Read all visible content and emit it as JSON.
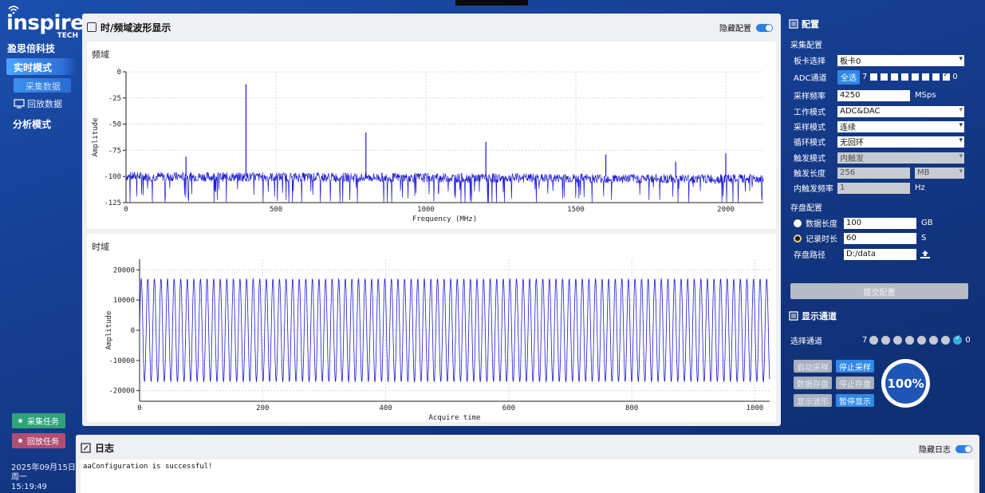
{
  "app": {
    "logo_text": "inspire",
    "logo_sub": "TECH",
    "company": "盈思倍科技"
  },
  "sidebar": {
    "realtime_mode": "实时模式",
    "collect_data": "采集数据",
    "replay_data": "回放数据",
    "analysis_mode": "分析模式",
    "collect_task": "采集任务",
    "replay_task": "回放任务",
    "date": "2025年09月15日",
    "weekday": "周一",
    "time": "15:19:49"
  },
  "main": {
    "title": "时/频域波形显示",
    "hide_config_label": "隐藏配置",
    "freq_panel_title": "频域",
    "time_panel_title": "时域"
  },
  "chart_data": [
    {
      "type": "line",
      "xlabel": "Frequency (MHz)",
      "ylabel": "Amplitude",
      "xlim": [
        0,
        2125
      ],
      "ylim": [
        -125,
        0
      ],
      "x_ticks": [
        0,
        500,
        1000,
        1500,
        2000
      ],
      "y_ticks": [
        0,
        -25,
        -50,
        -75,
        -100,
        -125
      ],
      "noise_floor": -100,
      "peaks": [
        {
          "x": 200,
          "y": -81
        },
        {
          "x": 400,
          "y": -12
        },
        {
          "x": 800,
          "y": -58
        },
        {
          "x": 1200,
          "y": -67
        },
        {
          "x": 1600,
          "y": -79
        },
        {
          "x": 1833,
          "y": -86
        },
        {
          "x": 2000,
          "y": -78
        }
      ],
      "grid": true,
      "color": "#1a18d8"
    },
    {
      "type": "line",
      "xlabel": "Acquire time",
      "ylabel": "Amplitude",
      "xlim": [
        0,
        1024
      ],
      "ylim": [
        -23500,
        23500
      ],
      "x_ticks": [
        0,
        200,
        400,
        600,
        800,
        1000
      ],
      "y_ticks": [
        20000,
        10000,
        0,
        -10000,
        -20000
      ],
      "amplitude": 17000,
      "period": 10.7,
      "grid": true,
      "color": "#1a18d8"
    }
  ],
  "config": {
    "title": "配置",
    "acq_section": "采集配置",
    "board_label": "板卡选择",
    "board_value": "板卡0",
    "adc_label": "ADC通道",
    "select_all": "全选",
    "adc_left_index": "7",
    "adc_right_index": "0",
    "sample_rate_label": "采样频率",
    "sample_rate_value": "4250",
    "sample_rate_unit": "MSps",
    "work_mode_label": "工作模式",
    "work_mode_value": "ADC&DAC",
    "sample_mode_label": "采样模式",
    "sample_mode_value": "连续",
    "loop_mode_label": "循环模式",
    "loop_mode_value": "无回环",
    "trigger_mode_label": "触发模式",
    "trigger_mode_value": "内触发",
    "trigger_len_label": "触发长度",
    "trigger_len_value": "256",
    "trigger_len_unit": "MB",
    "trigger_freq_label": "内触发频率",
    "trigger_freq_value": "1",
    "trigger_freq_unit": "Hz",
    "storage_section": "存盘配置",
    "data_len_label": "数据长度",
    "data_len_value": "100",
    "data_len_unit": "GB",
    "rec_time_label": "记录时长",
    "rec_time_value": "60",
    "rec_time_unit": "S",
    "path_label": "存盘路径",
    "path_value": "D:/data",
    "submit": "提交配置"
  },
  "display": {
    "title": "显示通道",
    "select_label": "选择通道",
    "left_index": "7",
    "right_index": "0",
    "start_sampling": "启动采样",
    "stop_sampling": "停止采样",
    "data_save": "数据存盘",
    "stop_save": "停止存盘",
    "show_wave": "显示波形",
    "pause_display": "暂停显示",
    "progress": "100%"
  },
  "log": {
    "title": "日志",
    "hide_label": "隐藏日志",
    "message": "aaConfiguration is successful!"
  }
}
